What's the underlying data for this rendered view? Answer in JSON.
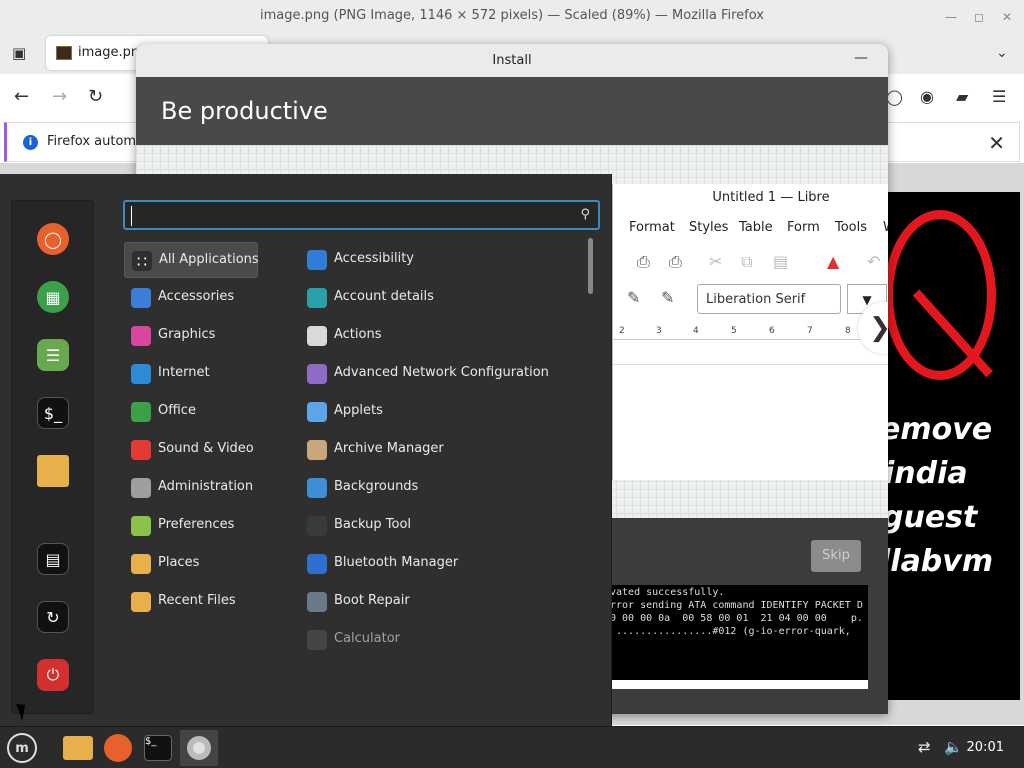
{
  "firefox": {
    "window_title": "image.png (PNG Image, 1146 × 572 pixels) — Scaled (89%) — Mozilla Firefox",
    "tab_label": "image.png",
    "infobar_text": "Firefox automa"
  },
  "image_text": [
    "emove",
    "india",
    "guest",
    "llabvm"
  ],
  "installer": {
    "title": "Install",
    "heading": "Be productive",
    "skip_label": "Skip",
    "terminal_lines": [
      "vated successfully.",
      "rror sending ATA command IDENTIFY PACKET D",
      "0 00 00 0a  00 58 00 01  21 04 00 00    p.",
      " ................#012 (g-io-error-quark,"
    ],
    "writer": {
      "title": "Untitled 1 — Libre",
      "menu": [
        "Format",
        "Styles",
        "Table",
        "Form",
        "Tools",
        "W"
      ],
      "font_name": "Liberation Serif",
      "ruler": [
        "2",
        "3",
        "4",
        "5",
        "6",
        "7",
        "8"
      ]
    }
  },
  "menu": {
    "search_placeholder": "",
    "categories": [
      {
        "label": "All Applications",
        "icon": "grid-icon",
        "color": "#2f2f2f"
      },
      {
        "label": "Accessories",
        "icon": "scissors-icon",
        "color": "#3b7dd8"
      },
      {
        "label": "Graphics",
        "icon": "palette-icon",
        "color": "#d946a0"
      },
      {
        "label": "Internet",
        "icon": "globe-icon",
        "color": "#2e8bd6"
      },
      {
        "label": "Office",
        "icon": "office-icon",
        "color": "#3aa14a"
      },
      {
        "label": "Sound & Video",
        "icon": "play-icon",
        "color": "#e53935"
      },
      {
        "label": "Administration",
        "icon": "admin-icon",
        "color": "#9e9e9e"
      },
      {
        "label": "Preferences",
        "icon": "preferences-icon",
        "color": "#8bc34a"
      },
      {
        "label": "Places",
        "icon": "folder-icon",
        "color": "#e8b04a"
      },
      {
        "label": "Recent Files",
        "icon": "recent-folder-icon",
        "color": "#e8b04a"
      }
    ],
    "apps": [
      {
        "label": "Accessibility",
        "icon": "accessibility-icon",
        "color": "#2e7dd6"
      },
      {
        "label": "Account details",
        "icon": "account-icon",
        "color": "#2aa1a8"
      },
      {
        "label": "Actions",
        "icon": "actions-icon",
        "color": "#d9d9d9"
      },
      {
        "label": "Advanced Network Configuration",
        "icon": "network-icon",
        "color": "#8e6bc4"
      },
      {
        "label": "Applets",
        "icon": "applets-icon",
        "color": "#5aa6e6"
      },
      {
        "label": "Archive Manager",
        "icon": "archive-icon",
        "color": "#c9a77c"
      },
      {
        "label": "Backgrounds",
        "icon": "backgrounds-icon",
        "color": "#3e8ed8"
      },
      {
        "label": "Backup Tool",
        "icon": "backup-icon",
        "color": "#3a3a3a"
      },
      {
        "label": "Bluetooth Manager",
        "icon": "bluetooth-icon",
        "color": "#2e6fd0"
      },
      {
        "label": "Boot Repair",
        "icon": "boot-repair-icon",
        "color": "#6a7a8a"
      },
      {
        "label": "Calculator",
        "icon": "calculator-icon",
        "color": "#555555"
      }
    ]
  },
  "taskbar": {
    "clock": "20:01"
  }
}
